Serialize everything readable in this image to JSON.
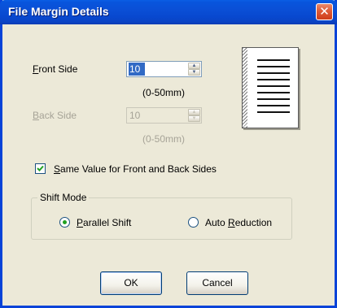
{
  "window": {
    "title": "File Margin Details",
    "close_glyph": "✕"
  },
  "front_side": {
    "label": "Front Side",
    "mnemonic": "F",
    "label_rest": "ront Side",
    "value": "10",
    "range": "(0-50mm)"
  },
  "back_side": {
    "label": "Back Side",
    "mnemonic": "B",
    "label_rest": "ack Side",
    "value": "10",
    "range": "(0-50mm)",
    "enabled": false
  },
  "same_value": {
    "mnemonic": "S",
    "label_rest": "ame Value for Front and Back Sides",
    "checked": true
  },
  "shift_mode": {
    "legend": "Shift Mode",
    "options": [
      {
        "mnemonic": "P",
        "label_rest": "arallel Shift",
        "selected": true
      },
      {
        "prefix": "Auto ",
        "mnemonic": "R",
        "label_rest": "eduction",
        "selected": false
      }
    ]
  },
  "buttons": {
    "ok": "OK",
    "cancel": "Cancel"
  },
  "icons": {
    "close": "close-icon",
    "page_preview": "page-preview-icon",
    "checkmark": "checkmark-icon",
    "spin_up": "spin-up-icon",
    "spin_down": "spin-down-icon"
  },
  "colors": {
    "titlebar": "#0a4fd6",
    "selection": "#316ac5",
    "dialog_bg": "#ece9d8",
    "disabled_text": "#a6a397",
    "radio_dot": "#21a121"
  }
}
